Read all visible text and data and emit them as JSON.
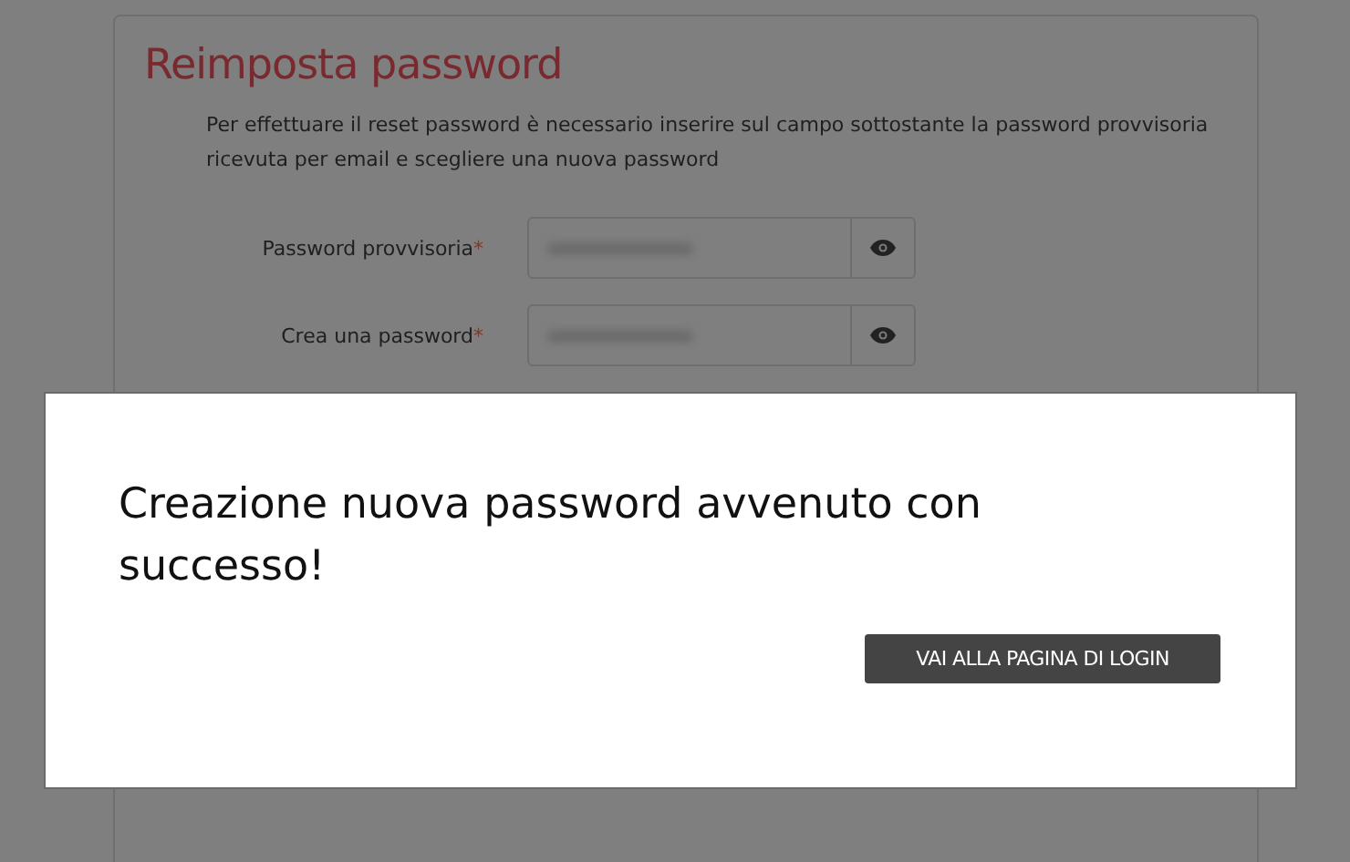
{
  "page": {
    "title": "Reimposta password",
    "description": "Per effettuare il reset password è necessario inserire sul campo sottostante la password provvisoria ricevuta per email e scegliere una nuova password",
    "fields": [
      {
        "label": "Password provvisoria",
        "required_mark": "*"
      },
      {
        "label": "Crea una password",
        "required_mark": "*"
      }
    ]
  },
  "dialog": {
    "message": "Creazione nuova password avvenuto con successo!",
    "button": "VAI ALLA PAGINA DI LOGIN"
  }
}
